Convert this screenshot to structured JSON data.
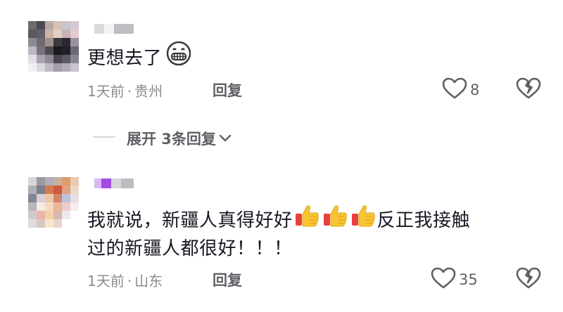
{
  "comments": [
    {
      "text": "更想去了",
      "emoji": "grinning-face",
      "time": "1天前",
      "location": "贵州",
      "reply_label": "回复",
      "likes": "8",
      "expand_label": "展开 3条回复"
    },
    {
      "text_line1": "我就说，新疆人真得好好",
      "thumbs_count": 3,
      "text_after": "反正我接触",
      "text_line2": "过的新疆人都很好！！！",
      "time": "1天前",
      "location": "山东",
      "reply_label": "回复",
      "likes": "35"
    }
  ],
  "separator": "·",
  "colors": {
    "text": "#161823",
    "meta": "#8a8b91",
    "action": "#5f6066"
  }
}
